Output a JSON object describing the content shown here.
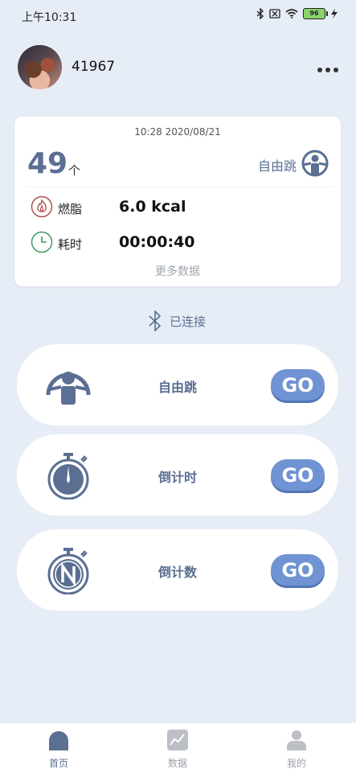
{
  "status_bar": {
    "time": "上午10:31",
    "battery": "96"
  },
  "user": {
    "name": "41967",
    "more_icon": "more-dots-icon"
  },
  "summary": {
    "datetime": "10:28 2020/08/21",
    "count": "49",
    "count_unit": "个",
    "mode": "自由跳",
    "metrics": [
      {
        "label": "燃脂",
        "value": "6.0 kcal",
        "icon": "flame-icon"
      },
      {
        "label": "耗时",
        "value": "00:00:40",
        "icon": "clock-icon"
      }
    ],
    "more_data": "更多数据"
  },
  "bluetooth": {
    "status": "已连接"
  },
  "modes": [
    {
      "label": "自由跳",
      "button": "GO",
      "icon": "free-jump-icon"
    },
    {
      "label": "倒计时",
      "button": "GO",
      "icon": "countdown-timer-icon"
    },
    {
      "label": "倒计数",
      "button": "GO",
      "icon": "countdown-count-icon"
    }
  ],
  "tabs": [
    {
      "label": "首页",
      "active": true,
      "icon": "home-icon"
    },
    {
      "label": "数据",
      "active": false,
      "icon": "chart-icon"
    },
    {
      "label": "我的",
      "active": false,
      "icon": "profile-icon"
    }
  ],
  "colors": {
    "accent": "#5b6f93",
    "button": "#6f93d3",
    "background": "#e7edf6"
  }
}
